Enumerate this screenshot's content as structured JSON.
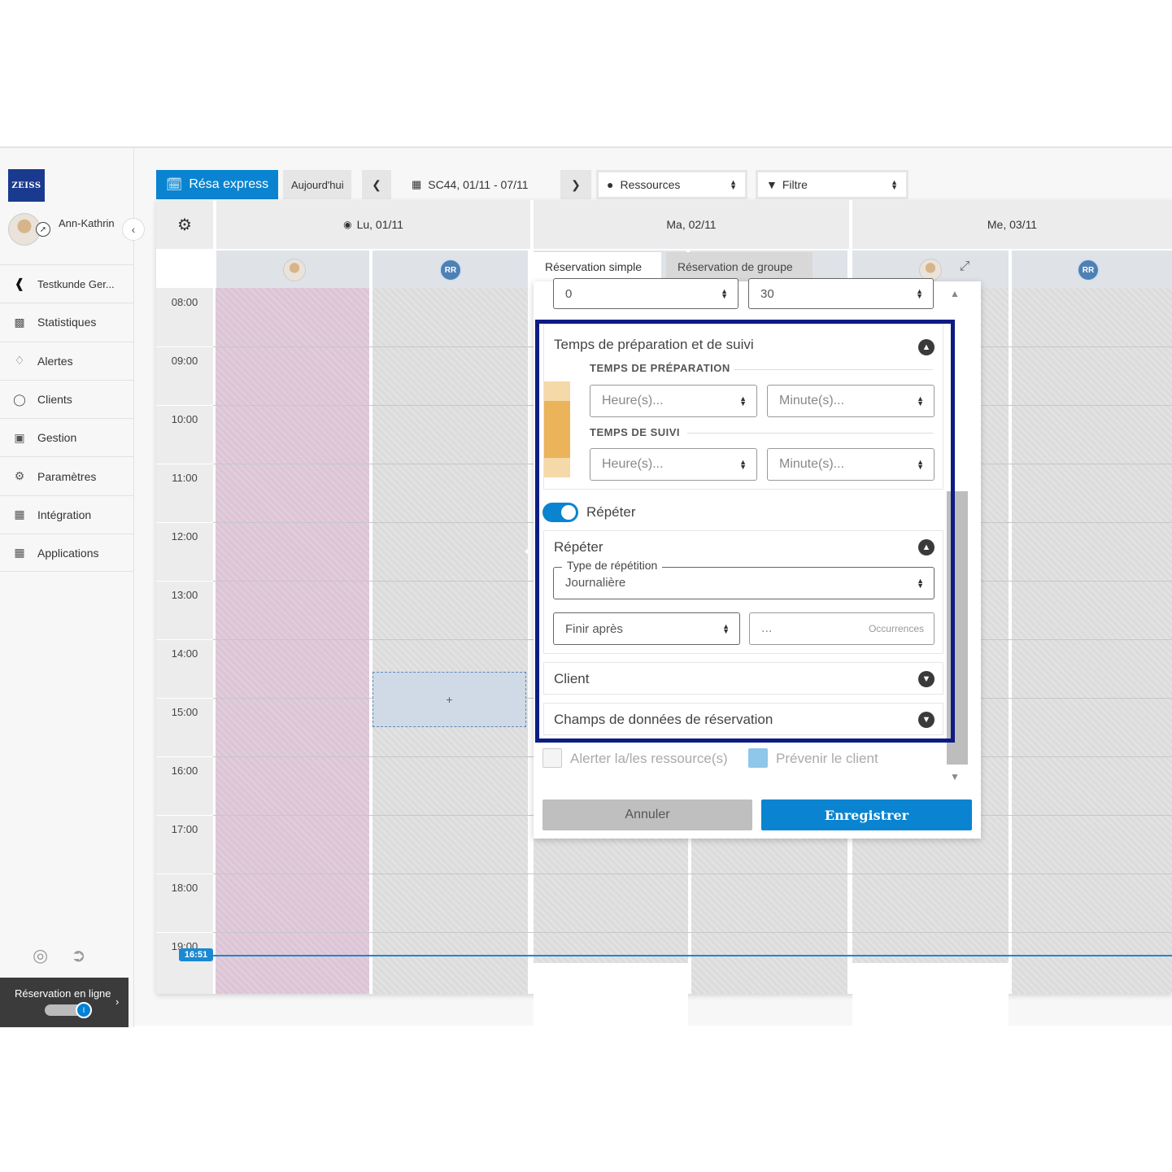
{
  "sidebar": {
    "logo": "ZEISS",
    "user_name": "Ann-Kathrin",
    "back_item": "Testkunde Ger...",
    "items": [
      {
        "label": "Statistiques",
        "icon": "chart-icon"
      },
      {
        "label": "Alertes",
        "icon": "bell-icon"
      },
      {
        "label": "Clients",
        "icon": "user-icon"
      },
      {
        "label": "Gestion",
        "icon": "briefcase-icon"
      },
      {
        "label": "Paramètres",
        "icon": "settings-icon"
      },
      {
        "label": "Intégration",
        "icon": "integration-icon"
      },
      {
        "label": "Applications",
        "icon": "grid-icon"
      }
    ],
    "online_label": "Réservation en ligne",
    "online_toggle_on": true
  },
  "toolbar": {
    "resa_express": "Résa express",
    "today": "Aujourd'hui",
    "date_range": "SC44, 01/11 - 07/11",
    "resources": "Ressources",
    "filter": "Filtre"
  },
  "calendar": {
    "days": [
      "Lu, 01/11",
      "Ma, 02/11",
      "Me, 03/11"
    ],
    "resources": [
      "photo",
      "RR"
    ],
    "times": [
      "08:00",
      "09:00",
      "10:00",
      "11:00",
      "12:00",
      "13:00",
      "14:00",
      "15:00",
      "16:00",
      "17:00",
      "18:00",
      "19:00"
    ],
    "now": "16:51",
    "new_slot": "+"
  },
  "popup": {
    "tab_simple": "Réservation simple",
    "tab_group": "Réservation de groupe",
    "duration_hours": "0",
    "duration_minutes": "30",
    "prep_section_title": "Temps de préparation et de suivi",
    "prep_label": "TEMPS DE PRÉPARATION",
    "followup_label": "TEMPS DE SUIVI",
    "hours_placeholder": "Heure(s)...",
    "minutes_placeholder": "Minute(s)...",
    "repeat_toggle_label": "Répéter",
    "repeat_toggle_on": true,
    "repeat_section_title": "Répéter",
    "repeat_type_legend": "Type de répétition",
    "repeat_type_value": "Journalière",
    "end_option": "Finir après",
    "occurrences_placeholder": "...",
    "occurrences_label": "Occurrences",
    "client_section": "Client",
    "fields_section": "Champs de données de réservation",
    "alert_resources": "Alerter la/les ressource(s)",
    "notify_client": "Prévenir le client",
    "cancel": "Annuler",
    "save": "Enregistrer"
  },
  "colors": {
    "accent": "#0a84d0",
    "highlight_frame": "#0d1c84",
    "prep_bar": "#ebb45a"
  }
}
